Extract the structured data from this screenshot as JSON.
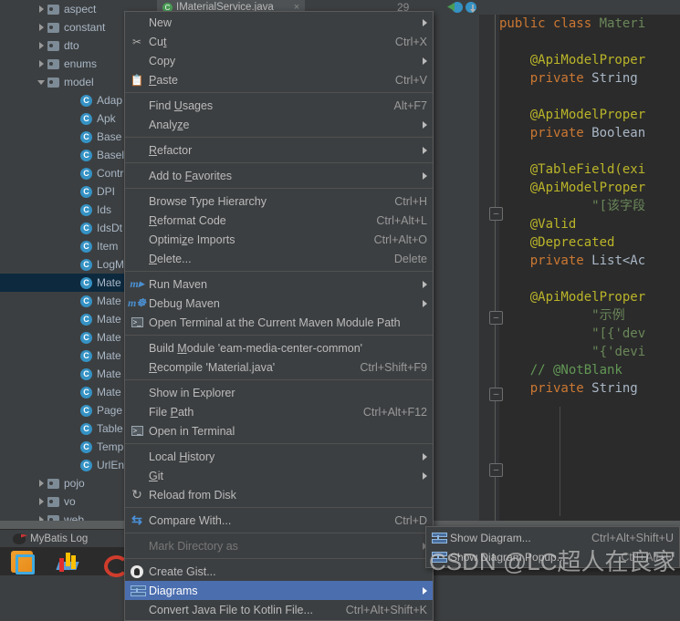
{
  "editor_tab": {
    "filename": "IMaterialService.java",
    "close_glyph": "×",
    "problem_count": "29"
  },
  "project_tree": {
    "items": [
      {
        "label": "aspect",
        "type": "folder",
        "indent": 1,
        "twisty": "collapsed",
        "selected": false
      },
      {
        "label": "constant",
        "type": "folder",
        "indent": 1,
        "twisty": "collapsed",
        "selected": false
      },
      {
        "label": "dto",
        "type": "folder",
        "indent": 1,
        "twisty": "collapsed",
        "selected": false
      },
      {
        "label": "enums",
        "type": "folder",
        "indent": 1,
        "twisty": "collapsed",
        "selected": false
      },
      {
        "label": "model",
        "type": "folder",
        "indent": 1,
        "twisty": "expanded",
        "selected": false
      },
      {
        "label": "Adap",
        "type": "class",
        "indent": 2,
        "twisty": "none",
        "selected": false
      },
      {
        "label": "Apk",
        "type": "class",
        "indent": 2,
        "twisty": "none",
        "selected": false
      },
      {
        "label": "Base",
        "type": "class",
        "indent": 2,
        "twisty": "none",
        "selected": false
      },
      {
        "label": "Basel",
        "type": "class",
        "indent": 2,
        "twisty": "none",
        "selected": false
      },
      {
        "label": "Contr",
        "type": "class",
        "indent": 2,
        "twisty": "none",
        "selected": false
      },
      {
        "label": "DPI",
        "type": "class",
        "indent": 2,
        "twisty": "none",
        "selected": false
      },
      {
        "label": "Ids",
        "type": "class",
        "indent": 2,
        "twisty": "none",
        "selected": false
      },
      {
        "label": "IdsDt",
        "type": "class",
        "indent": 2,
        "twisty": "none",
        "selected": false
      },
      {
        "label": "Item",
        "type": "class",
        "indent": 2,
        "twisty": "none",
        "selected": false
      },
      {
        "label": "LogM",
        "type": "class",
        "indent": 2,
        "twisty": "none",
        "selected": false
      },
      {
        "label": "Mate",
        "type": "class",
        "indent": 2,
        "twisty": "none",
        "selected": true
      },
      {
        "label": "Mate",
        "type": "class",
        "indent": 2,
        "twisty": "none",
        "selected": false
      },
      {
        "label": "Mate",
        "type": "class",
        "indent": 2,
        "twisty": "none",
        "selected": false
      },
      {
        "label": "Mate",
        "type": "class",
        "indent": 2,
        "twisty": "none",
        "selected": false
      },
      {
        "label": "Mate",
        "type": "class",
        "indent": 2,
        "twisty": "none",
        "selected": false
      },
      {
        "label": "Mate",
        "type": "class",
        "indent": 2,
        "twisty": "none",
        "selected": false
      },
      {
        "label": "Mate",
        "type": "class",
        "indent": 2,
        "twisty": "none",
        "selected": false
      },
      {
        "label": "Page",
        "type": "class",
        "indent": 2,
        "twisty": "none",
        "selected": false
      },
      {
        "label": "Table",
        "type": "class",
        "indent": 2,
        "twisty": "none",
        "selected": false
      },
      {
        "label": "Temp",
        "type": "class",
        "indent": 2,
        "twisty": "none",
        "selected": false
      },
      {
        "label": "UrlEn",
        "type": "class",
        "indent": 2,
        "twisty": "none",
        "selected": false
      },
      {
        "label": "pojo",
        "type": "folder",
        "indent": 1,
        "twisty": "collapsed",
        "selected": false
      },
      {
        "label": "vo",
        "type": "folder",
        "indent": 1,
        "twisty": "collapsed",
        "selected": false
      },
      {
        "label": "web",
        "type": "folder",
        "indent": 1,
        "twisty": "collapsed",
        "selected": false
      }
    ]
  },
  "context_menu": {
    "items": [
      {
        "label": "New",
        "accel": "",
        "icon": "",
        "submenu": true,
        "selected": false,
        "disabled": false,
        "sep_after": false,
        "mnemonic": ""
      },
      {
        "label": "Cut",
        "accel": "Ctrl+X",
        "icon": "scissors-icon",
        "submenu": false,
        "selected": false,
        "disabled": false,
        "sep_after": false,
        "mnemonic": "t"
      },
      {
        "label": "Copy",
        "accel": "",
        "icon": "",
        "submenu": true,
        "selected": false,
        "disabled": false,
        "sep_after": false,
        "mnemonic": ""
      },
      {
        "label": "Paste",
        "accel": "Ctrl+V",
        "icon": "clipboard-icon",
        "submenu": false,
        "selected": false,
        "disabled": false,
        "sep_after": true,
        "mnemonic": "P"
      },
      {
        "label": "Find Usages",
        "accel": "Alt+F7",
        "icon": "",
        "submenu": false,
        "selected": false,
        "disabled": false,
        "sep_after": false,
        "mnemonic": "U"
      },
      {
        "label": "Analyze",
        "accel": "",
        "icon": "",
        "submenu": true,
        "selected": false,
        "disabled": false,
        "sep_after": true,
        "mnemonic": "z"
      },
      {
        "label": "Refactor",
        "accel": "",
        "icon": "",
        "submenu": true,
        "selected": false,
        "disabled": false,
        "sep_after": true,
        "mnemonic": "R"
      },
      {
        "label": "Add to Favorites",
        "accel": "",
        "icon": "",
        "submenu": true,
        "selected": false,
        "disabled": false,
        "sep_after": true,
        "mnemonic": "F"
      },
      {
        "label": "Browse Type Hierarchy",
        "accel": "Ctrl+H",
        "icon": "",
        "submenu": false,
        "selected": false,
        "disabled": false,
        "sep_after": false,
        "mnemonic": ""
      },
      {
        "label": "Reformat Code",
        "accel": "Ctrl+Alt+L",
        "icon": "",
        "submenu": false,
        "selected": false,
        "disabled": false,
        "sep_after": false,
        "mnemonic": "R"
      },
      {
        "label": "Optimize Imports",
        "accel": "Ctrl+Alt+O",
        "icon": "",
        "submenu": false,
        "selected": false,
        "disabled": false,
        "sep_after": false,
        "mnemonic": "z"
      },
      {
        "label": "Delete...",
        "accel": "Delete",
        "icon": "",
        "submenu": false,
        "selected": false,
        "disabled": false,
        "sep_after": true,
        "mnemonic": "D"
      },
      {
        "label": "Run Maven",
        "accel": "",
        "icon": "maven-run-icon",
        "submenu": true,
        "selected": false,
        "disabled": false,
        "sep_after": false,
        "mnemonic": ""
      },
      {
        "label": "Debug Maven",
        "accel": "",
        "icon": "maven-debug-icon",
        "submenu": true,
        "selected": false,
        "disabled": false,
        "sep_after": false,
        "mnemonic": ""
      },
      {
        "label": "Open Terminal at the Current Maven Module Path",
        "accel": "",
        "icon": "terminal-maven-icon",
        "submenu": false,
        "selected": false,
        "disabled": false,
        "sep_after": true,
        "mnemonic": ""
      },
      {
        "label": "Build Module 'eam-media-center-common'",
        "accel": "",
        "icon": "",
        "submenu": false,
        "selected": false,
        "disabled": false,
        "sep_after": false,
        "mnemonic": "M"
      },
      {
        "label": "Recompile 'Material.java'",
        "accel": "Ctrl+Shift+F9",
        "icon": "",
        "submenu": false,
        "selected": false,
        "disabled": false,
        "sep_after": true,
        "mnemonic": "R"
      },
      {
        "label": "Show in Explorer",
        "accel": "",
        "icon": "",
        "submenu": false,
        "selected": false,
        "disabled": false,
        "sep_after": false,
        "mnemonic": ""
      },
      {
        "label": "File Path",
        "accel": "Ctrl+Alt+F12",
        "icon": "",
        "submenu": false,
        "selected": false,
        "disabled": false,
        "sep_after": false,
        "mnemonic": "P"
      },
      {
        "label": "Open in Terminal",
        "accel": "",
        "icon": "terminal-icon",
        "submenu": false,
        "selected": false,
        "disabled": false,
        "sep_after": true,
        "mnemonic": ""
      },
      {
        "label": "Local History",
        "accel": "",
        "icon": "",
        "submenu": true,
        "selected": false,
        "disabled": false,
        "sep_after": false,
        "mnemonic": "H"
      },
      {
        "label": "Git",
        "accel": "",
        "icon": "",
        "submenu": true,
        "selected": false,
        "disabled": false,
        "sep_after": false,
        "mnemonic": "G"
      },
      {
        "label": "Reload from Disk",
        "accel": "",
        "icon": "reload-icon",
        "submenu": false,
        "selected": false,
        "disabled": false,
        "sep_after": true,
        "mnemonic": ""
      },
      {
        "label": "Compare With...",
        "accel": "Ctrl+D",
        "icon": "compare-icon",
        "submenu": false,
        "selected": false,
        "disabled": false,
        "sep_after": true,
        "mnemonic": ""
      },
      {
        "label": "Mark Directory as",
        "accel": "",
        "icon": "",
        "submenu": true,
        "selected": false,
        "disabled": true,
        "sep_after": true,
        "mnemonic": ""
      },
      {
        "label": "Create Gist...",
        "accel": "",
        "icon": "github-icon",
        "submenu": false,
        "selected": false,
        "disabled": false,
        "sep_after": false,
        "mnemonic": ""
      },
      {
        "label": "Diagrams",
        "accel": "",
        "icon": "diagram-icon",
        "submenu": true,
        "selected": true,
        "disabled": false,
        "sep_after": false,
        "mnemonic": ""
      },
      {
        "label": "Convert Java File to Kotlin File...",
        "accel": "Ctrl+Alt+Shift+K",
        "icon": "",
        "submenu": false,
        "selected": false,
        "disabled": false,
        "sep_after": false,
        "mnemonic": ""
      }
    ]
  },
  "diagrams_submenu": {
    "items": [
      {
        "label": "Show Diagram...",
        "accel": "Ctrl+Alt+Shift+U",
        "icon": "diagram-icon"
      },
      {
        "label": "Show Diagram Popup...",
        "accel": "Ctrl+Alt+U",
        "icon": "diagram-icon"
      }
    ]
  },
  "bottom_toolwindow": {
    "label": "MyBatis Log"
  },
  "watermark": {
    "text": "CSDN @LC超人在良家"
  },
  "code": {
    "lines": [
      {
        "indent": 0,
        "tokens": [
          {
            "t": "public ",
            "c": "kw"
          },
          {
            "t": "class ",
            "c": "kw"
          },
          {
            "t": "Materi",
            "c": "cls"
          }
        ]
      },
      {
        "indent": 0,
        "tokens": []
      },
      {
        "indent": 4,
        "tokens": [
          {
            "t": "@ApiModelProper",
            "c": "ann"
          }
        ]
      },
      {
        "indent": 4,
        "tokens": [
          {
            "t": "private ",
            "c": "kw"
          },
          {
            "t": "String ",
            "c": "typ"
          }
        ]
      },
      {
        "indent": 0,
        "tokens": []
      },
      {
        "indent": 4,
        "tokens": [
          {
            "t": "@ApiModelProper",
            "c": "ann"
          }
        ]
      },
      {
        "indent": 4,
        "tokens": [
          {
            "t": "private ",
            "c": "kw"
          },
          {
            "t": "Boolean",
            "c": "typ"
          }
        ]
      },
      {
        "indent": 0,
        "tokens": []
      },
      {
        "indent": 4,
        "tokens": [
          {
            "t": "@TableField(exi",
            "c": "ann"
          }
        ]
      },
      {
        "indent": 4,
        "tokens": [
          {
            "t": "@ApiModelProper",
            "c": "ann"
          }
        ]
      },
      {
        "indent": 12,
        "tokens": [
          {
            "t": "\"[该字段",
            "c": "str"
          }
        ]
      },
      {
        "indent": 4,
        "tokens": [
          {
            "t": "@Valid",
            "c": "ann"
          }
        ]
      },
      {
        "indent": 4,
        "tokens": [
          {
            "t": "@Deprecated",
            "c": "ann"
          }
        ]
      },
      {
        "indent": 4,
        "tokens": [
          {
            "t": "private ",
            "c": "kw"
          },
          {
            "t": "List<Ac",
            "c": "typ"
          }
        ]
      },
      {
        "indent": 0,
        "tokens": []
      },
      {
        "indent": 4,
        "tokens": [
          {
            "t": "@ApiModelProper",
            "c": "ann"
          }
        ]
      },
      {
        "indent": 12,
        "tokens": [
          {
            "t": "\"示例  ",
            "c": "str"
          }
        ]
      },
      {
        "indent": 12,
        "tokens": [
          {
            "t": "\"[{'dev",
            "c": "str"
          }
        ]
      },
      {
        "indent": 12,
        "tokens": [
          {
            "t": "\"{'devi",
            "c": "str"
          }
        ]
      },
      {
        "indent": 4,
        "tokens": [
          {
            "t": "// @NotBlank",
            "c": "cmt"
          }
        ]
      },
      {
        "indent": 4,
        "tokens": [
          {
            "t": "private ",
            "c": "kw"
          },
          {
            "t": "String",
            "c": "typ"
          }
        ]
      }
    ]
  }
}
